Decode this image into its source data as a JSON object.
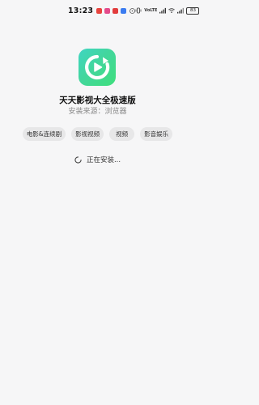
{
  "status_bar": {
    "time": "13:23",
    "battery": "83",
    "network_label": "VoLTE",
    "notification_colors": [
      "#e8433d",
      "#e44b8a",
      "#e23c3c",
      "#3b7cf0"
    ]
  },
  "app": {
    "name": "天天影视大全极速版",
    "source": "安装来源：浏览器",
    "icon": "play-refresh-icon"
  },
  "tags": [
    "电影&连续剧",
    "影视视频",
    "视频",
    "影音娱乐"
  ],
  "install": {
    "status_text": "正在安装..."
  }
}
